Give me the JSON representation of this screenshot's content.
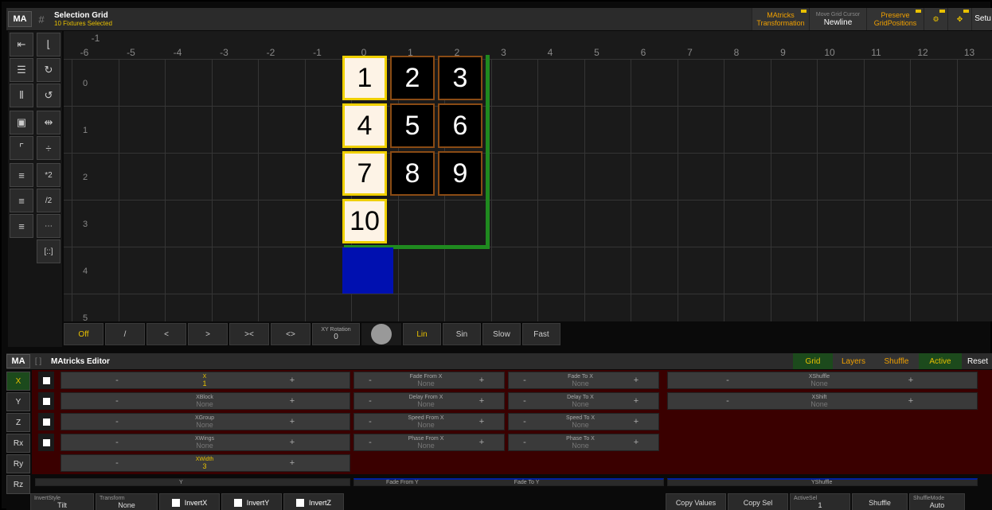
{
  "top": {
    "logo": "MA",
    "title": "Selection Grid",
    "subtitle": "10 Fixtures Selected",
    "btn_matricks": "MAtricks\nTransformation",
    "move_cursor_label": "Move Grid Cursor",
    "move_cursor_value": "Newline",
    "preserve": "Preserve GridPositions",
    "setup": "Setu"
  },
  "grid": {
    "col_labels": [
      "-6",
      "-5",
      "-4",
      "-3",
      "-2",
      "-1",
      "0",
      "1",
      "2",
      "3",
      "4",
      "5",
      "6",
      "7",
      "8",
      "9",
      "10",
      "11",
      "12",
      "13"
    ],
    "corner_label": "-1",
    "row_labels": [
      "0",
      "1",
      "2",
      "3",
      "4",
      "5"
    ],
    "cells": [
      "1",
      "2",
      "3",
      "4",
      "5",
      "6",
      "7",
      "8",
      "9",
      "10"
    ]
  },
  "gridbar": {
    "items": [
      "Off",
      "/",
      "<",
      ">",
      "><",
      "<>"
    ],
    "xy_label": "XY Rotation",
    "xy_value": "0",
    "modes": [
      "Lin",
      "Sin",
      "Slow",
      "Fast"
    ]
  },
  "editor": {
    "logo": "MA",
    "title": "MAtricks Editor",
    "tabs": {
      "grid": "Grid",
      "layers": "Layers",
      "shuffle": "Shuffle",
      "active": "Active",
      "reset": "Reset"
    },
    "axes": [
      "X",
      "Y",
      "Z",
      "Rx",
      "Ry",
      "Rz"
    ],
    "minus": "-",
    "plus": "+",
    "x_rows": [
      {
        "label": "X",
        "value": "1"
      },
      {
        "label": "XBlock",
        "value": "None"
      },
      {
        "label": "XGroup",
        "value": "None"
      },
      {
        "label": "XWings",
        "value": "None"
      },
      {
        "label": "XWidth",
        "value": "3"
      }
    ],
    "fade_rows": [
      {
        "from": "Fade From X",
        "to": "Fade To X"
      },
      {
        "from": "Delay From X",
        "to": "Delay To X"
      },
      {
        "from": "Speed From X",
        "to": "Speed To X"
      },
      {
        "from": "Phase From X",
        "to": "Phase To X"
      }
    ],
    "none": "None",
    "shuffle_rows": [
      {
        "label": "XShuffle",
        "value": "None"
      },
      {
        "label": "XShift",
        "value": "None"
      }
    ],
    "y_row": {
      "label": "Y",
      "from": "Fade From Y",
      "to": "Fade To Y",
      "shuffle": "YShuffle"
    }
  },
  "bottom": {
    "invert_style_label": "InvertStyle",
    "invert_style": "Tilt",
    "transform_label": "Transform",
    "transform": "None",
    "invert_x": "InvertX",
    "invert_y": "InvertY",
    "invert_z": "InvertZ",
    "copy_values": "Copy Values",
    "copy_sel": "Copy Sel",
    "active_sel_label": "ActiveSel",
    "active_sel": "1",
    "shuffle": "Shuffle",
    "shuffle_mode_label": "ShuffleMode",
    "shuffle_mode": "Auto"
  },
  "colors": {
    "accent": "#e8c000",
    "green": "#1f8a1f",
    "blue": "#0010b0",
    "cellborder": "#8a4b14"
  }
}
